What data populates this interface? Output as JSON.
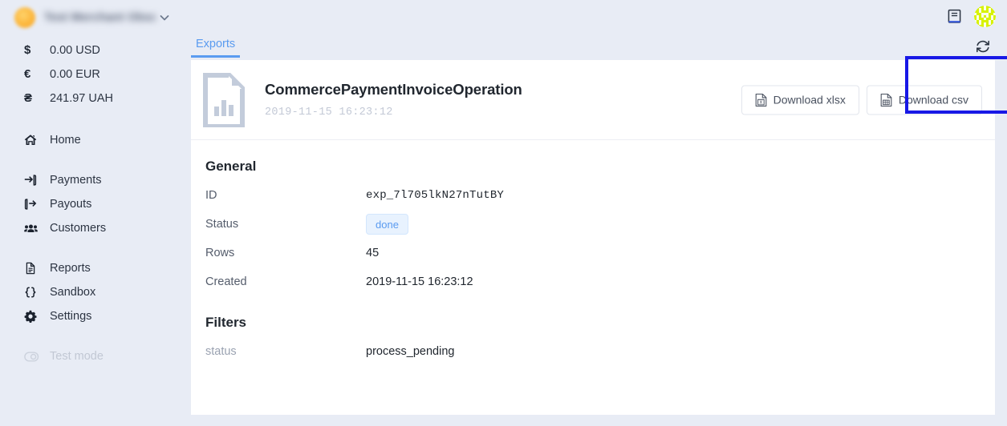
{
  "sidebar": {
    "merchant": {
      "name": "Test Merchant Obscured",
      "avatar_icon": "avatar-orange",
      "chevron_icon": "chevron-down-icon"
    },
    "balances": [
      {
        "symbol": "$",
        "amount": "0.00 USD"
      },
      {
        "symbol": "€",
        "amount": "0.00 EUR"
      },
      {
        "symbol": "₴",
        "amount": "241.97 UAH"
      }
    ],
    "nav_primary": [
      {
        "label": "Home",
        "icon": "home-icon"
      }
    ],
    "nav_secondary": [
      {
        "label": "Payments",
        "icon": "sign-in-arrow-icon"
      },
      {
        "label": "Payouts",
        "icon": "sign-out-arrow-icon"
      },
      {
        "label": "Customers",
        "icon": "users-icon"
      }
    ],
    "nav_tertiary": [
      {
        "label": "Reports",
        "icon": "document-icon"
      },
      {
        "label": "Sandbox",
        "icon": "code-braces-icon"
      },
      {
        "label": "Settings",
        "icon": "gear-icon"
      }
    ],
    "test_mode": {
      "label": "Test mode",
      "icon": "toggle-off-icon",
      "enabled": false
    }
  },
  "topbar": {
    "docs_icon": "book-icon",
    "avatar_icon": "identicon-avatar",
    "refresh_icon": "refresh-icon"
  },
  "tabs": [
    {
      "label": "Exports",
      "active": true
    }
  ],
  "export": {
    "icon": "file-chart-icon",
    "title": "CommercePaymentInvoiceOperation",
    "date": "2019-11-15 16:23:12",
    "actions": [
      {
        "label": "Download xlsx",
        "icon": "file-xlsx-icon"
      },
      {
        "label": "Download csv",
        "icon": "file-csv-icon"
      }
    ]
  },
  "general": {
    "heading": "General",
    "rows": [
      {
        "key": "ID",
        "value": "exp_7l705lkN27nTutBY",
        "type": "mono"
      },
      {
        "key": "Status",
        "value": "done",
        "type": "badge"
      },
      {
        "key": "Rows",
        "value": "45",
        "type": "text"
      },
      {
        "key": "Created",
        "value": "2019-11-15 16:23:12",
        "type": "text"
      }
    ]
  },
  "filters": {
    "heading": "Filters",
    "rows": [
      {
        "key": "status",
        "value": "process_pending"
      }
    ]
  },
  "colors": {
    "accent_blue": "#5a9bf0",
    "page_bg": "#e8ecf5",
    "card_bg": "#ffffff",
    "highlight_box": "#1818e6",
    "badge_text": "#5a9bf0",
    "avatar_orange": "#f6a623",
    "identicon_green": "#d7f205"
  }
}
